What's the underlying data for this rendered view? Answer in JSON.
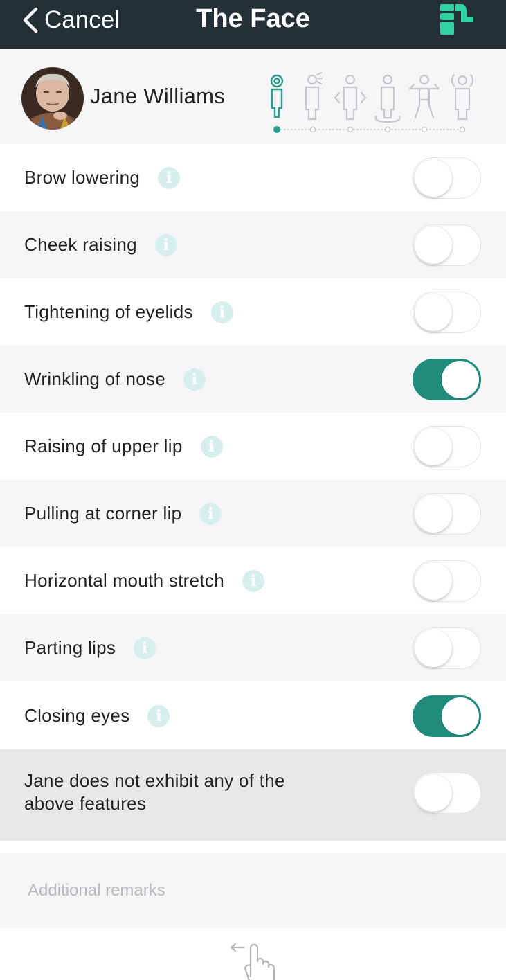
{
  "nav": {
    "cancel_label": "Cancel",
    "title": "The Face"
  },
  "profile": {
    "name": "Jane Williams",
    "steps_total": 6,
    "current_step": 1
  },
  "features": [
    {
      "label": "Brow lowering",
      "on": false
    },
    {
      "label": "Cheek raising",
      "on": false
    },
    {
      "label": "Tightening of eyelids",
      "on": false
    },
    {
      "label": "Wrinkling of nose",
      "on": true
    },
    {
      "label": "Raising of upper lip",
      "on": false
    },
    {
      "label": "Pulling at corner lip",
      "on": false
    },
    {
      "label": "Horizontal mouth stretch",
      "on": false
    },
    {
      "label": "Parting lips",
      "on": false
    },
    {
      "label": "Closing eyes",
      "on": true
    }
  ],
  "none_option": {
    "label": "Jane does not exhibit any of the above features",
    "on": false
  },
  "remarks": {
    "placeholder": "Additional remarks",
    "value": ""
  },
  "colors": {
    "nav_bg": "#233037",
    "accent": "#1f8c7e",
    "logo_green": "#2fd39f",
    "info_icon": "#d7efec"
  },
  "icons": {
    "back": "chevron-left-icon",
    "logo": "app-logo-icon",
    "info": "info-icon",
    "swipe": "swipe-left-hand-icon"
  }
}
